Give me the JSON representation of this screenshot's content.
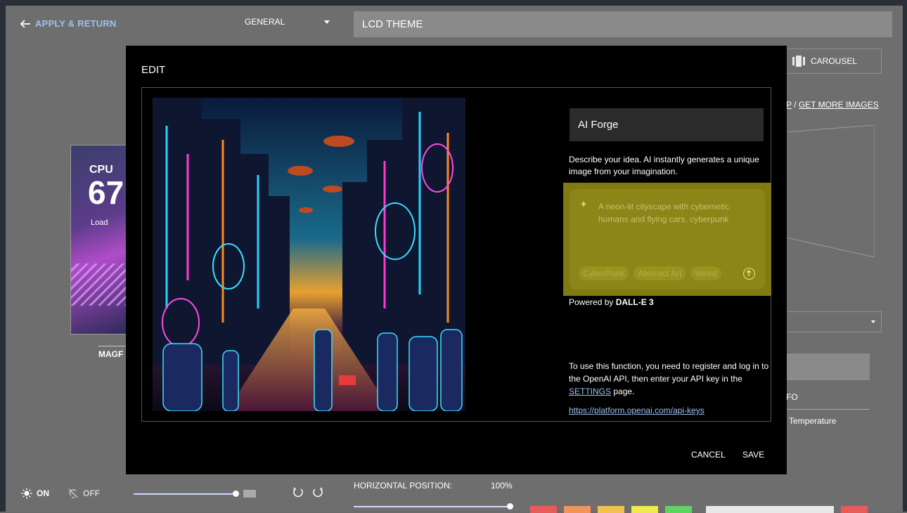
{
  "header": {
    "back_label": "APPLY & RETURN",
    "category_select": "GENERAL",
    "theme_name": "LCD THEME"
  },
  "right_panel": {
    "carousel_label": "CAROUSEL",
    "link_partial": "P",
    "link_separator": "/",
    "get_more_images": "GET MORE IMAGES",
    "info_label": "FO",
    "temperature_label": "Temperature"
  },
  "theme_card": {
    "cpu_label": "CPU",
    "value": "67",
    "load_label": "Load",
    "name": "MAGF"
  },
  "bottom_bar": {
    "on_label": "ON",
    "off_label": "OFF",
    "horizontal_position_label": "HORIZONTAL POSITION:",
    "horizontal_position_value": "100%",
    "swatch_colors": [
      "#e85b5b",
      "#f0945a",
      "#f2c24e",
      "#f0ea4e",
      "#5fd35f"
    ]
  },
  "modal": {
    "title": "EDIT",
    "panel_title": "AI Forge",
    "description": "Describe your idea. AI instantly generates a unique image from your imagination.",
    "prompt_placeholder": "A neon-lit cityscape with cybernetic humans and flying cars, cyberpunk",
    "chips": [
      "CyberPunk",
      "Abstract Art",
      "Weird"
    ],
    "powered_prefix": "Powered by",
    "powered_engine": "DALL-E 3",
    "info_before": "To use this function, you need to register and log in to the OpenAI API, then enter your API key in the",
    "settings_link": "SETTINGS",
    "info_after": "page.",
    "api_link": "https://platform.openai.com/api-keys",
    "cancel_label": "CANCEL",
    "save_label": "SAVE",
    "highlight_color": "#807a10"
  }
}
